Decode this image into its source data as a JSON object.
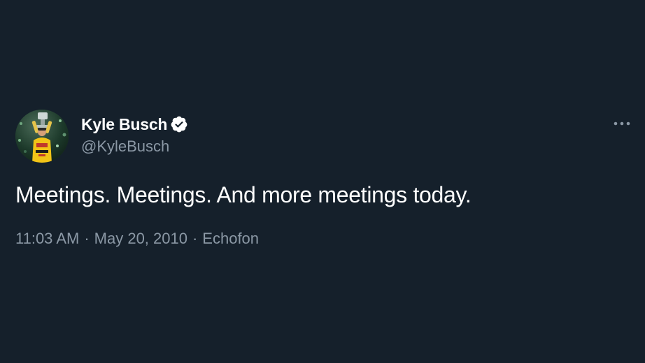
{
  "tweet": {
    "author": {
      "display_name": "Kyle Busch",
      "handle": "@KyleBusch",
      "verified": true,
      "avatar_icon": "avatar-photo"
    },
    "text": "Meetings. Meetings. And more meetings today.",
    "meta": {
      "time": "11:03 AM",
      "date": "May 20, 2010",
      "source": "Echofon",
      "separator": "·"
    },
    "more_icon": "more-horizontal-icon"
  },
  "colors": {
    "background": "#15202b",
    "primary_text": "#ffffff",
    "secondary_text": "#8b98a5"
  }
}
